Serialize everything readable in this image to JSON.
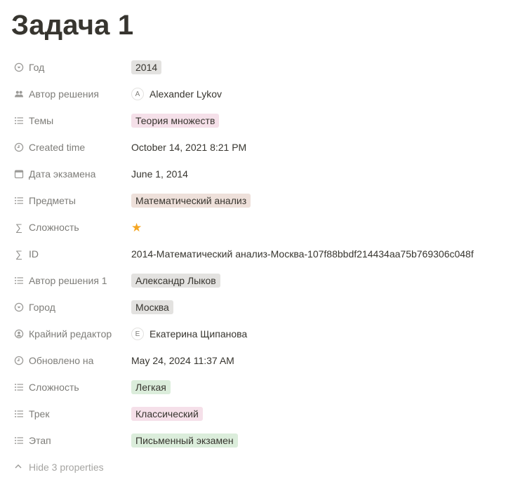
{
  "page": {
    "title": "Задача 1"
  },
  "properties": [
    {
      "name": "Год",
      "icon": "select-icon",
      "type": "tag",
      "value": "2014",
      "color": "#e3e2e0"
    },
    {
      "name": "Автор решения",
      "icon": "people-icon",
      "type": "person",
      "value": "Alexander Lykov",
      "initial": "A"
    },
    {
      "name": "Темы",
      "icon": "list-icon",
      "type": "tag",
      "value": "Теория множеств",
      "color": "#f5e0e9"
    },
    {
      "name": "Created time",
      "icon": "clock-icon",
      "type": "text",
      "value": "October 14, 2021 8:21 PM"
    },
    {
      "name": "Дата экзамена",
      "icon": "calendar-icon",
      "type": "text",
      "value": "June 1, 2014"
    },
    {
      "name": "Предметы",
      "icon": "list-icon",
      "type": "tag",
      "value": "Математический анализ",
      "color": "#eee0da"
    },
    {
      "name": "Сложность",
      "icon": "sigma-icon",
      "type": "star",
      "value": "★",
      "rating": 1
    },
    {
      "name": "ID",
      "icon": "sigma-icon",
      "type": "text",
      "value": "2014-Математический анализ-Москва-107f88bbdf214434aa75b769306c048f"
    },
    {
      "name": "Автор решения 1",
      "icon": "list-icon",
      "type": "tag",
      "value": "Александр Лыков",
      "color": "#e3e2e0"
    },
    {
      "name": "Город",
      "icon": "select-icon",
      "type": "tag",
      "value": "Москва",
      "color": "#e3e2e0"
    },
    {
      "name": "Крайний редактор",
      "icon": "person-circle-icon",
      "type": "person",
      "value": "Екатерина Щипанова",
      "initial": "E"
    },
    {
      "name": "Обновлено на",
      "icon": "clock-icon",
      "type": "text",
      "value": "May 24, 2024 11:37 AM"
    },
    {
      "name": "Сложность",
      "icon": "list-icon",
      "type": "tag",
      "value": "Легкая",
      "color": "#dbeddb"
    },
    {
      "name": "Трек",
      "icon": "list-icon",
      "type": "tag",
      "value": "Классический",
      "color": "#f5e0e9"
    },
    {
      "name": "Этап",
      "icon": "list-icon",
      "type": "tag",
      "value": "Письменный экзамен",
      "color": "#dbeddb"
    }
  ],
  "hide_properties": {
    "label": "Hide 3 properties",
    "icon": "chevron-up-icon"
  },
  "colors": {
    "text": "#37352f",
    "muted": "#9b9a97",
    "star": "#f5a623"
  }
}
